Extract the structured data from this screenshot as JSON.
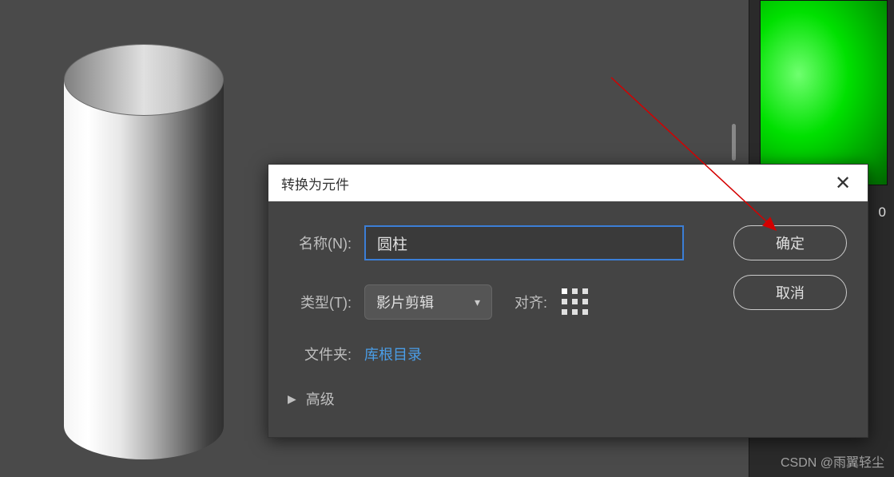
{
  "dialog": {
    "title": "转换为元件",
    "name_label": "名称(N):",
    "name_value": "圆柱",
    "type_label": "类型(T):",
    "type_value": "影片剪辑",
    "align_label": "对齐:",
    "folder_label": "文件夹:",
    "folder_value": "库根目录",
    "advanced_label": "高级",
    "ok_label": "确定",
    "cancel_label": "取消"
  },
  "panel": {
    "value": "0"
  },
  "watermark": "CSDN @雨翼轻尘"
}
